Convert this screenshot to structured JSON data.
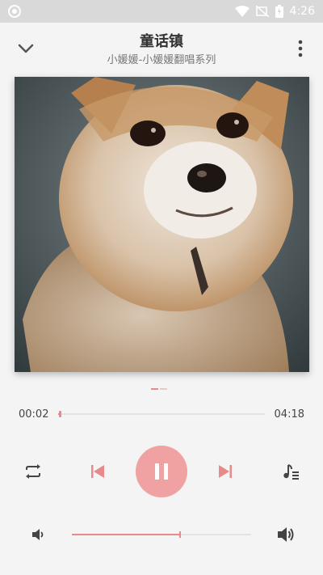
{
  "status_bar": {
    "time": "4:26"
  },
  "header": {
    "title": "童话镇",
    "subtitle": "小媛媛-小媛媛翻唱系列"
  },
  "album_art": {
    "icon": "album-art-image"
  },
  "pager": {
    "pages": 2,
    "active": 0
  },
  "progress": {
    "current": "00:02",
    "total": "04:18",
    "fraction": 0.005
  },
  "controls": {
    "repeat_icon": "repeat-icon",
    "prev_icon": "skip-previous-icon",
    "play_icon": "pause-icon",
    "next_icon": "skip-next-icon",
    "playlist_icon": "playlist-icon"
  },
  "volume": {
    "level": 0.6
  },
  "colors": {
    "accent": "#f0a2a2",
    "accent_dark": "#e88a8a"
  }
}
